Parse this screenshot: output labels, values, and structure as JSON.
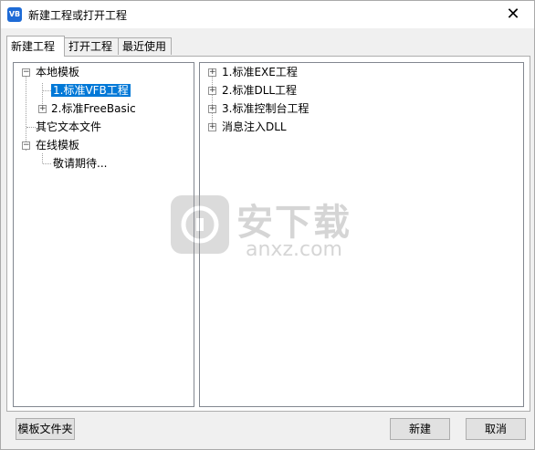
{
  "window": {
    "title": "新建工程或打开工程",
    "icon": "vfb-app-icon",
    "icon_text": "VB",
    "close_glyph": "✕"
  },
  "tabs": [
    {
      "label": "新建工程",
      "active": true
    },
    {
      "label": "打开工程",
      "active": false
    },
    {
      "label": "最近使用",
      "active": false
    }
  ],
  "left_tree": {
    "local_templates": "本地模板",
    "item_vfb": "1.标准VFB工程",
    "item_freebasic": "2.标准FreeBasic",
    "other_text_files": "其它文本文件",
    "online_templates": "在线模板",
    "coming_soon": "敬请期待..."
  },
  "right_tree": {
    "items": [
      "1.标准EXE工程",
      "2.标准DLL工程",
      "3.标准控制台工程",
      "消息注入DLL"
    ]
  },
  "buttons": {
    "template_folder": "模板文件夹",
    "new": "新建",
    "cancel": "取消"
  },
  "watermark": {
    "brand": "安下载",
    "domain": "anxz.com"
  },
  "colors": {
    "selection": "#0078d7",
    "icon_blue": "#1e6bd6"
  }
}
